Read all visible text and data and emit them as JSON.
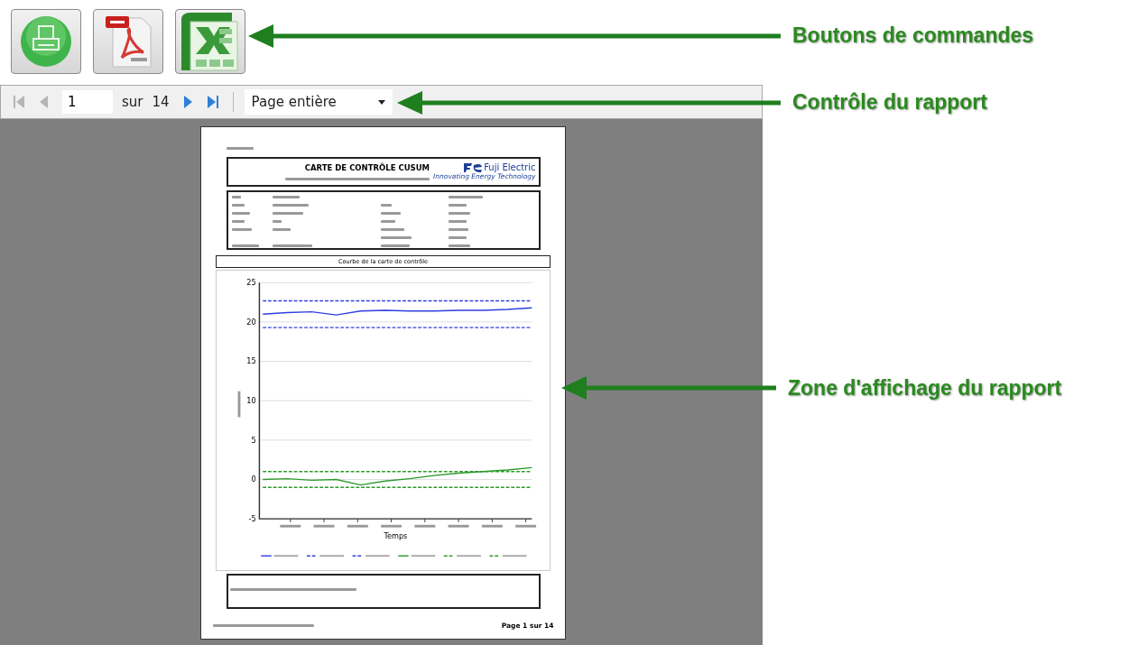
{
  "command_buttons": [
    {
      "kind": "print"
    },
    {
      "kind": "pdf"
    },
    {
      "kind": "excel"
    }
  ],
  "toolbar": {
    "nav_buttons": [
      {
        "kind": "first",
        "disabled": true
      },
      {
        "kind": "prev",
        "disabled": true
      },
      {
        "kind": "next",
        "disabled": false
      },
      {
        "kind": "last",
        "disabled": false
      }
    ],
    "page": "1",
    "of_label": "sur",
    "total": "14",
    "zoom": "Page entière"
  },
  "report": {
    "title": "CARTE DE CONTRÔLE CUSUM",
    "logo_name": "Fuji Electric",
    "logo_tagline": "Innovating Energy Technology",
    "chart_title": "Courbe de la carte de contrôle",
    "footer_page": "Page 1 sur 14",
    "chart_data": {
      "type": "line",
      "xlabel": "Temps",
      "grid": true,
      "ylim": [
        -5,
        25
      ],
      "yticks": [
        -5,
        0,
        5,
        10,
        15,
        20,
        25
      ],
      "series": [
        {
          "color": "#2f3fe0",
          "line_style": "solid",
          "values": [
            21.0,
            21.2,
            21.3,
            20.9,
            21.4,
            21.5,
            21.4,
            21.4,
            21.5,
            21.5,
            21.6,
            21.8
          ]
        },
        {
          "color": "#2f3fe0",
          "line_style": "dashed",
          "values": [
            19.3,
            19.3,
            19.3,
            19.3,
            19.3,
            19.3,
            19.3,
            19.3,
            19.3,
            19.3,
            19.3,
            19.3
          ]
        },
        {
          "color": "#2f3fe0",
          "line_style": "dashed",
          "values": [
            22.7,
            22.7,
            22.7,
            22.7,
            22.7,
            22.7,
            22.7,
            22.7,
            22.7,
            22.7,
            22.7,
            22.7
          ]
        },
        {
          "color": "#2a9a2a",
          "line_style": "solid",
          "values": [
            0.0,
            0.1,
            -0.1,
            0.0,
            -0.7,
            -0.2,
            0.1,
            0.5,
            0.8,
            1.0,
            1.2,
            1.5
          ]
        },
        {
          "color": "#2a9a2a",
          "line_style": "dashed",
          "values": [
            -1,
            -1,
            -1,
            -1,
            -1,
            -1,
            -1,
            -1,
            -1,
            -1,
            -1,
            -1
          ]
        },
        {
          "color": "#2a9a2a",
          "line_style": "dashed",
          "values": [
            1,
            1,
            1,
            1,
            1,
            1,
            1,
            1,
            1,
            1,
            1,
            1
          ]
        }
      ]
    }
  },
  "annotations": [
    {
      "label": "Boutons de commandes"
    },
    {
      "label": "Contrôle du rapport"
    },
    {
      "label": "Zone d'affichage du rapport"
    }
  ]
}
